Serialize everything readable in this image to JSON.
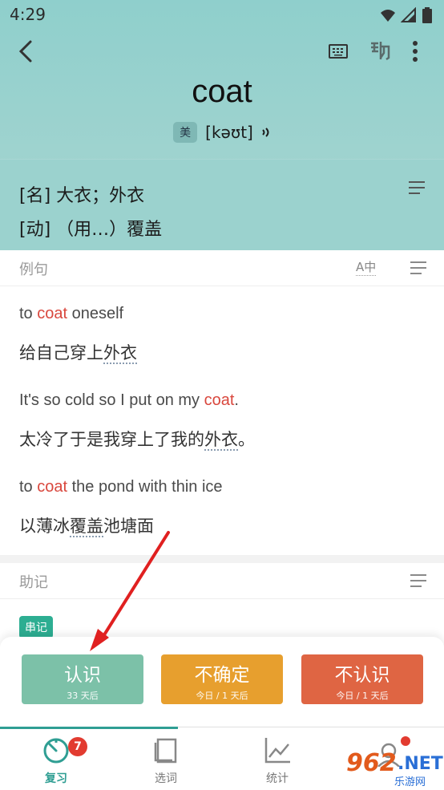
{
  "status": {
    "time": "4:29"
  },
  "word": {
    "text": "coat",
    "accent": "美",
    "phonetic": "[kəʊt]",
    "speaker": "🔊"
  },
  "definitions": [
    "[名] 大衣；外衣",
    "[动] （用…）覆盖"
  ],
  "examples_section": {
    "title": "例句",
    "translate_toggle": "A中",
    "items": [
      {
        "en_before": "to ",
        "en_hl": "coat",
        "en_after": " oneself",
        "zh_before": "给自己穿上",
        "zh_dot": "外衣",
        "zh_after": ""
      },
      {
        "en_before": "It's so cold so I put on my ",
        "en_hl": "coat",
        "en_after": ".",
        "zh_before": "太冷了于是我穿上了我的",
        "zh_dot": "外衣",
        "zh_after": "。"
      },
      {
        "en_before": "to ",
        "en_hl": "coat",
        "en_after": " the pond with thin ice",
        "zh_before": "以薄冰",
        "zh_dot": "覆盖",
        "zh_after": "池塘面"
      }
    ]
  },
  "mnemonic_section": {
    "title": "助记",
    "tag": "串记"
  },
  "actions": {
    "know": {
      "label": "认识",
      "sub": "33 天后",
      "color": "#7cc1a8"
    },
    "unsure": {
      "label": "不确定",
      "sub": "今日 / 1 天后",
      "color": "#e79f2e"
    },
    "unknown": {
      "label": "不认识",
      "sub": "今日 / 1 天后",
      "color": "#df6543"
    }
  },
  "tabs": {
    "review": {
      "label": "复习",
      "badge": "7",
      "icon": "timer-icon"
    },
    "choose": {
      "label": "选词",
      "icon": "book-icon"
    },
    "stats": {
      "label": "统计",
      "icon": "chart-icon"
    }
  },
  "watermark": {
    "num": "962",
    "dot": ".NET",
    "sub": "乐游网"
  },
  "colors": {
    "accent": "#2f9e93",
    "highlight": "#d9473d",
    "header": "#9bd2ce"
  }
}
